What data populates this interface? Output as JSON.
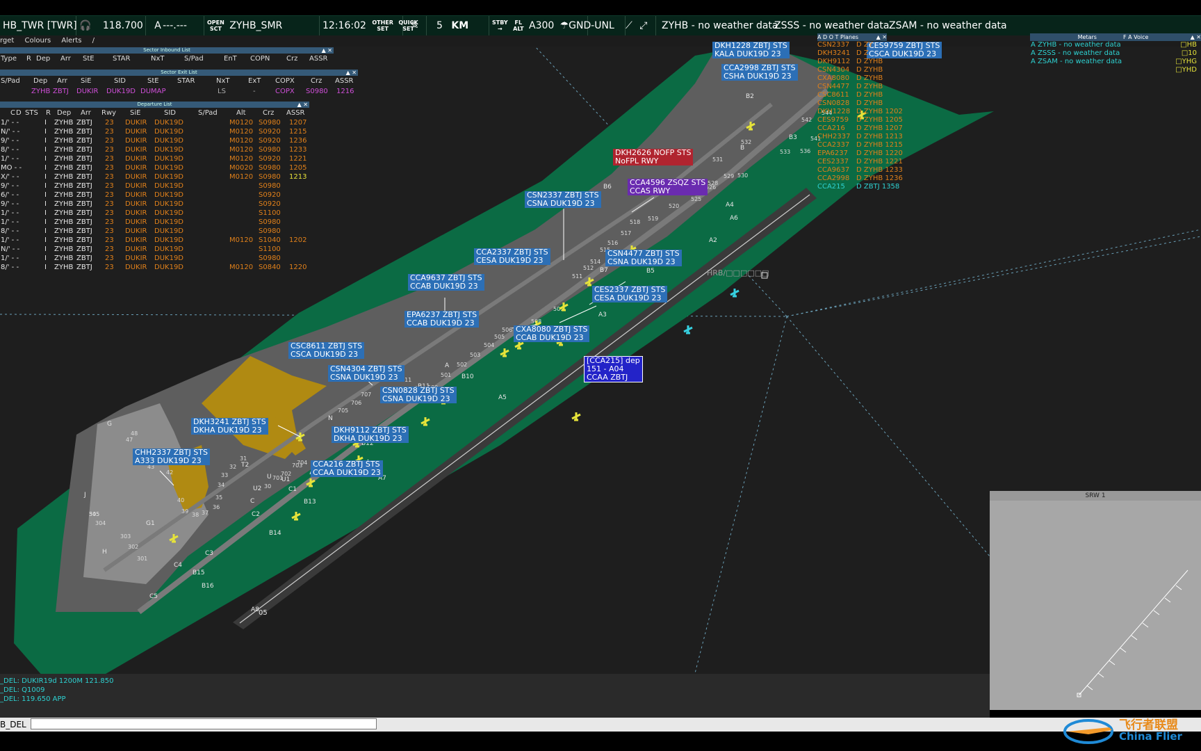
{
  "topbar": {
    "position": "HB_TWR [TWR]",
    "freq": "118.700",
    "atis": "A",
    "freq2": "---.---",
    "open_sct_top": "OPEN",
    "open_sct_bot": "SCT",
    "sector": "ZYHB_SMR",
    "time": "12:16:02",
    "other_set_top": "OTHER",
    "other_set_bot": "SET",
    "quick_set_top": "QUICK",
    "quick_set_bot": "SET",
    "range": "5",
    "unit": "KM",
    "stby_top": "STBY",
    "stby_bot": "→",
    "flalt_top": "FL",
    "flalt_bot": "ALT",
    "transition": "A300",
    "level_filter": "GND-UNL",
    "wx1": "ZYHB - no weather data",
    "wx2": "ZSSS - no weather data",
    "wx3": "ZSAM - no weather data"
  },
  "submenu": [
    "rget",
    "Colours",
    "Alerts",
    "/"
  ],
  "sector_inbound": {
    "title": "Sector Inbound List",
    "headers": [
      "Type",
      "R",
      "Dep",
      "Arr",
      "StE",
      "STAR",
      "NxT",
      "S/Pad",
      "EnT",
      "COPN",
      "Crz",
      "ASSR"
    ]
  },
  "sector_exit": {
    "title": "Sector Exit List",
    "headers": [
      "S/Pad",
      "Dep",
      "Arr",
      "SiE",
      "SID",
      "StE",
      "STAR",
      "NxT",
      "ExT",
      "COPX",
      "Crz",
      "ASSR"
    ],
    "row": [
      "ZYHB",
      "ZBTJ",
      "DUKIR",
      "DUK19D",
      "DUMAP",
      "LS",
      "-",
      "COPX",
      "S0980",
      "1216"
    ]
  },
  "departure_list": {
    "title": "Departure List",
    "headers": [
      "C",
      "D",
      "STS",
      "R",
      "Dep",
      "Arr",
      "Rwy",
      "SiE",
      "SID",
      "S/Pad",
      "Alt",
      "Crz",
      "ASSR"
    ],
    "rows": [
      {
        "pre": "1/' - -",
        "r": "I",
        "dep": "ZYHB",
        "arr": "ZBTJ",
        "rwy": "23",
        "sie": "DUKIR",
        "sid": "DUK19D",
        "alt": "M0120",
        "crz": "S0980",
        "assr": "1207"
      },
      {
        "pre": "N/' - -",
        "r": "I",
        "dep": "ZYHB",
        "arr": "ZBTJ",
        "rwy": "23",
        "sie": "DUKIR",
        "sid": "DUK19D",
        "alt": "M0120",
        "crz": "S0920",
        "assr": "1215"
      },
      {
        "pre": "9/' - -",
        "r": "I",
        "dep": "ZYHB",
        "arr": "ZBTJ",
        "rwy": "23",
        "sie": "DUKIR",
        "sid": "DUK19D",
        "alt": "M0120",
        "crz": "S0920",
        "assr": "1236"
      },
      {
        "pre": "8/' - -",
        "r": "I",
        "dep": "ZYHB",
        "arr": "ZBTJ",
        "rwy": "23",
        "sie": "DUKIR",
        "sid": "DUK19D",
        "alt": "M0120",
        "crz": "S0980",
        "assr": "1233"
      },
      {
        "pre": "1/' - -",
        "r": "I",
        "dep": "ZYHB",
        "arr": "ZBTJ",
        "rwy": "23",
        "sie": "DUKIR",
        "sid": "DUK19D",
        "alt": "M0120",
        "crz": "S0920",
        "assr": "1221"
      },
      {
        "pre": "MO - -",
        "r": "I",
        "dep": "ZYHB",
        "arr": "ZBTJ",
        "rwy": "23",
        "sie": "DUKIR",
        "sid": "DUK19D",
        "alt": "M0020",
        "crz": "S0980",
        "assr": "1205"
      },
      {
        "pre": "X/' - -",
        "r": "I",
        "dep": "ZYHB",
        "arr": "ZBTJ",
        "rwy": "23",
        "sie": "DUKIR",
        "sid": "DUK19D",
        "alt": "M0120",
        "crz": "S0980",
        "assr": "1213",
        "hl": true
      },
      {
        "pre": "9/' - -",
        "r": "I",
        "dep": "ZYHB",
        "arr": "ZBTJ",
        "rwy": "23",
        "sie": "DUKIR",
        "sid": "DUK19D",
        "alt": "",
        "crz": "S0980",
        "assr": ""
      },
      {
        "pre": "6/' - -",
        "r": "I",
        "dep": "ZYHB",
        "arr": "ZBTJ",
        "rwy": "23",
        "sie": "DUKIR",
        "sid": "DUK19D",
        "alt": "",
        "crz": "S0920",
        "assr": ""
      },
      {
        "pre": "9/' - -",
        "r": "I",
        "dep": "ZYHB",
        "arr": "ZBTJ",
        "rwy": "23",
        "sie": "DUKIR",
        "sid": "DUK19D",
        "alt": "",
        "crz": "S0920",
        "assr": ""
      },
      {
        "pre": "1/' - -",
        "r": "I",
        "dep": "ZYHB",
        "arr": "ZBTJ",
        "rwy": "23",
        "sie": "DUKIR",
        "sid": "DUK19D",
        "alt": "",
        "crz": "S1100",
        "assr": ""
      },
      {
        "pre": "1/' - -",
        "r": "I",
        "dep": "ZYHB",
        "arr": "ZBTJ",
        "rwy": "23",
        "sie": "DUKIR",
        "sid": "DUK19D",
        "alt": "",
        "crz": "S0980",
        "assr": ""
      },
      {
        "pre": "8/' - -",
        "r": "I",
        "dep": "ZYHB",
        "arr": "ZBTJ",
        "rwy": "23",
        "sie": "DUKIR",
        "sid": "DUK19D",
        "alt": "",
        "crz": "S0980",
        "assr": ""
      },
      {
        "pre": "1/' - -",
        "r": "I",
        "dep": "ZYHB",
        "arr": "ZBTJ",
        "rwy": "23",
        "sie": "DUKIR",
        "sid": "DUK19D",
        "alt": "M0120",
        "crz": "S1040",
        "assr": "1202"
      },
      {
        "pre": "N/' - -",
        "r": "I",
        "dep": "ZYHB",
        "arr": "ZBTJ",
        "rwy": "23",
        "sie": "DUKIR",
        "sid": "DUK19D",
        "alt": "",
        "crz": "S1100",
        "assr": ""
      },
      {
        "pre": "1/' - -",
        "r": "I",
        "dep": "ZYHB",
        "arr": "ZBTJ",
        "rwy": "23",
        "sie": "DUKIR",
        "sid": "DUK19D",
        "alt": "",
        "crz": "S0980",
        "assr": ""
      },
      {
        "pre": "8/' - -",
        "r": "I",
        "dep": "ZYHB",
        "arr": "ZBTJ",
        "rwy": "23",
        "sie": "DUKIR",
        "sid": "DUK19D",
        "alt": "M0120",
        "crz": "S0840",
        "assr": "1220"
      }
    ]
  },
  "metars": {
    "title": "Metars",
    "lines": [
      "A ZYHB - no weather data",
      "A ZSSS - no weather data",
      "A ZSAM - no weather data"
    ]
  },
  "voice": {
    "title": "F A Voice",
    "lines": [
      "□HB",
      "□10",
      "□YHG",
      "□YHD"
    ]
  },
  "planes": {
    "title": "A D O T  Planes",
    "rows": [
      {
        "cs": "CSN2337",
        "info": "D ZY",
        "c": "o"
      },
      {
        "cs": "DKH3241",
        "info": "D Z",
        "c": "o"
      },
      {
        "cs": "DKH9112",
        "info": "D ZYHB",
        "c": "o"
      },
      {
        "cs": "CSN4304",
        "info": "D ZYHB",
        "c": "o"
      },
      {
        "cs": "CXA8080",
        "info": "D ZYHB",
        "c": "o"
      },
      {
        "cs": "CSN4477",
        "info": "D ZYHB",
        "c": "o"
      },
      {
        "cs": "CSC8611",
        "info": "D ZYHB",
        "c": "o"
      },
      {
        "cs": "CSN0828",
        "info": "D ZYHB",
        "c": "o"
      },
      {
        "cs": "DKH1228",
        "info": "D ZYHB 1202",
        "c": "o"
      },
      {
        "cs": "CES9759",
        "info": "D ZYHB 1205",
        "c": "o"
      },
      {
        "cs": "CCA216",
        "info": "D ZYHB 1207",
        "c": "o"
      },
      {
        "cs": "CHH2337",
        "info": "D ZYHB 1213",
        "c": "o"
      },
      {
        "cs": "CCA2337",
        "info": "D ZYHB 1215",
        "c": "o"
      },
      {
        "cs": "EPA6237",
        "info": "D ZYHB 1220",
        "c": "o"
      },
      {
        "cs": "CES2337",
        "info": "D ZYHB 1221",
        "c": "o"
      },
      {
        "cs": "CCA9637",
        "info": "D ZYHB 1233",
        "c": "o"
      },
      {
        "cs": "CCA2998",
        "info": "D ZYHB 1236",
        "c": "o"
      },
      {
        "cs": "CCA215",
        "info": "D ZBTJ 1358",
        "c": "c"
      }
    ]
  },
  "labels": [
    {
      "id": "dkh1228",
      "l1": "DKH1228  ZBTJ  STS",
      "l2": "KALA  DUK19D  23",
      "cls": ""
    },
    {
      "id": "cca2998",
      "l1": "CCA2998  ZBTJ  STS",
      "l2": "CSHA  DUK19D  23",
      "cls": ""
    },
    {
      "id": "ces9759",
      "l1": "CES9759  ZBTJ  STS",
      "l2": "CSCA  DUK19D  23",
      "cls": ""
    },
    {
      "id": "dkh2626",
      "l1": "DKH2626  NOFP  STS",
      "l2": "NoFPL  RWY",
      "cls": "red"
    },
    {
      "id": "cca4596",
      "l1": "CCA4596  ZSQZ  STS",
      "l2": "CCAS  RWY",
      "cls": "purple"
    },
    {
      "id": "csn2337",
      "l1": "CSN2337  ZBTJ  STS",
      "l2": "CSNA  DUK19D  23",
      "cls": ""
    },
    {
      "id": "cca2337",
      "l1": "CCA2337  ZBTJ  STS",
      "l2": "CESA  DUK19D  23",
      "cls": ""
    },
    {
      "id": "csn4477",
      "l1": "CSN4477  ZBTJ  STS",
      "l2": "CSNA  DUK19D  23",
      "cls": ""
    },
    {
      "id": "cca9637",
      "l1": "CCA9637  ZBTJ  STS",
      "l2": "CCAB  DUK19D  23",
      "cls": ""
    },
    {
      "id": "ces2337",
      "l1": "CES2337  ZBTJ  STS",
      "l2": "CESA  DUK19D  23",
      "cls": ""
    },
    {
      "id": "epa6237",
      "l1": "EPA6237  ZBTJ  STS",
      "l2": "CCAB  DUK19D  23",
      "cls": ""
    },
    {
      "id": "cxa8080",
      "l1": "CXA8080  ZBTJ  STS",
      "l2": "CCAB  DUK19D  23",
      "cls": ""
    },
    {
      "id": "csc8611",
      "l1": "CSC8611  ZBTJ  STS",
      "l2": "CSCA  DUK19D  23",
      "cls": ""
    },
    {
      "id": "csn4304",
      "l1": "CSN4304  ZBTJ  STS",
      "l2": "CSNA  DUK19D  23",
      "cls": ""
    },
    {
      "id": "csn0828",
      "l1": "CSN0828  ZBTJ  STS",
      "l2": "CSNA  DUK19D  23",
      "cls": ""
    },
    {
      "id": "dkh3241",
      "l1": "DKH3241  ZBTJ  STS",
      "l2": "DKHA  DUK19D  23",
      "cls": ""
    },
    {
      "id": "dkh9112",
      "l1": "DKH9112  ZBTJ  STS",
      "l2": "DKHA  DUK19D  23",
      "cls": ""
    },
    {
      "id": "chh2337",
      "l1": "CHH2337  ZBTJ  STS",
      "l2": "A333  DUK19D  23",
      "cls": ""
    },
    {
      "id": "cca216",
      "l1": "CCA216  ZBTJ  STS",
      "l2": "CCAA  DUK19D  23",
      "cls": ""
    },
    {
      "id": "cca215",
      "l1": "[CCA215]  dep",
      "l2": "151  -  A04",
      "l3": "CCAA  ZBTJ",
      "cls": "sel"
    }
  ],
  "map_text": {
    "hrb": "HRB/□□□□□□",
    "rwy05": "05",
    "taxiways": [
      "A",
      "A2",
      "A3",
      "A4",
      "A5",
      "A6",
      "A7",
      "A8",
      "B",
      "B2",
      "B3",
      "B5",
      "B6",
      "B7",
      "B10",
      "B11",
      "B12",
      "B13",
      "B14",
      "B15",
      "B16",
      "C",
      "C1",
      "C2",
      "C3",
      "C4",
      "C5",
      "G",
      "G1",
      "H",
      "J",
      "N",
      "T2",
      "U",
      "U1",
      "U2"
    ],
    "stands": [
      "305",
      "304",
      "303",
      "302",
      "301",
      "47",
      "48",
      "45",
      "44",
      "43",
      "42",
      "40",
      "39",
      "38",
      "37",
      "36",
      "35",
      "34",
      "33",
      "32",
      "31",
      "30",
      "701",
      "702",
      "703",
      "704",
      "705",
      "706",
      "707",
      "708",
      "711",
      "500",
      "501",
      "502",
      "503",
      "504",
      "505",
      "506",
      "507",
      "508",
      "509",
      "511",
      "512",
      "514",
      "515",
      "516",
      "517",
      "518",
      "519",
      "520",
      "525",
      "526",
      "528",
      "529",
      "530",
      "531",
      "532",
      "533",
      "536",
      "541",
      "542",
      "544",
      "545"
    ]
  },
  "srw": {
    "title": "SRW 1"
  },
  "messages": [
    "_DEL: DUKIR19d 1200M 121.850",
    "_DEL:  Q1009",
    "_DEL: 119.650 APP"
  ],
  "command": {
    "label": "B_DEL",
    "value": ""
  },
  "watermark": {
    "cn": "飞行者联盟",
    "en": "China Flier"
  },
  "colors": {
    "grass": "#0b6b44",
    "taxi": "#5e5e5e",
    "apron": "#8c8c8c",
    "label": "#2c6fb6",
    "bg": "#1e1e1e"
  }
}
